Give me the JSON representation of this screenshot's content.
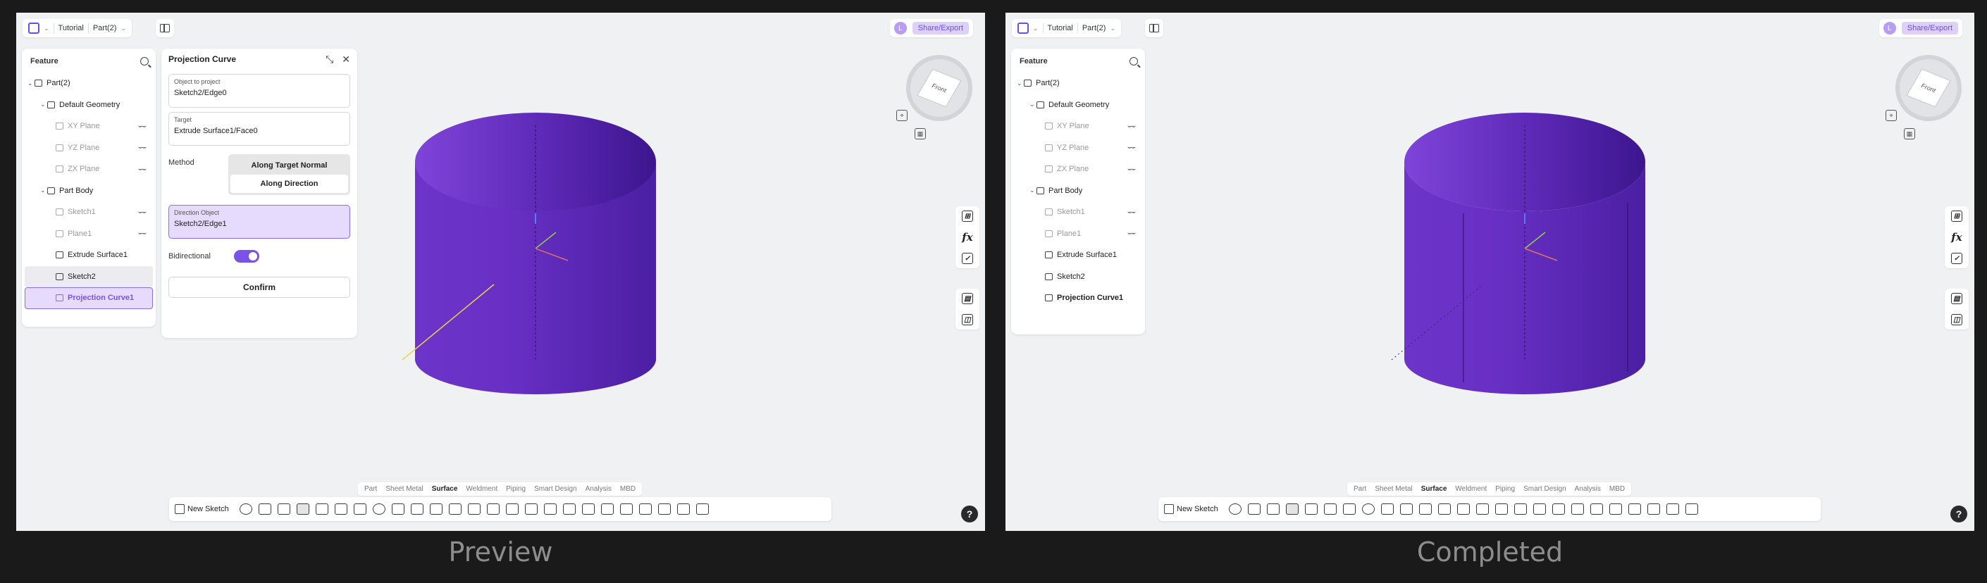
{
  "app": {
    "breadcrumb": [
      "Tutorial",
      "Part(2)"
    ],
    "avatar_initial": "L",
    "share_label": "Share/Export"
  },
  "tree": {
    "title": "Feature",
    "items": [
      {
        "label": "Part(2)",
        "level": 0,
        "caret": true,
        "hidden": false,
        "eye": false
      },
      {
        "label": "Default Geometry",
        "level": 1,
        "caret": true,
        "hidden": false,
        "eye": false
      },
      {
        "label": "XY Plane",
        "level": 2,
        "caret": false,
        "hidden": true,
        "eye": true
      },
      {
        "label": "YZ Plane",
        "level": 2,
        "caret": false,
        "hidden": true,
        "eye": true
      },
      {
        "label": "ZX Plane",
        "level": 2,
        "caret": false,
        "hidden": true,
        "eye": true
      },
      {
        "label": "Part Body",
        "level": 1,
        "caret": true,
        "hidden": false,
        "eye": false
      },
      {
        "label": "Sketch1",
        "level": 2,
        "caret": false,
        "hidden": true,
        "eye": true
      },
      {
        "label": "Plane1",
        "level": 2,
        "caret": false,
        "hidden": true,
        "eye": true
      },
      {
        "label": "Extrude Surface1",
        "level": 2,
        "caret": false,
        "hidden": false,
        "eye": false
      },
      {
        "label": "Sketch2",
        "level": 2,
        "caret": false,
        "hidden": false,
        "eye": false
      },
      {
        "label": "Projection Curve1",
        "level": 2,
        "caret": false,
        "hidden": false,
        "eye": false
      }
    ]
  },
  "dialog": {
    "title": "Projection Curve",
    "object_label": "Object to project",
    "object_value": "Sketch2/Edge0",
    "target_label": "Target",
    "target_value": "Extrude Surface1/Face0",
    "method_label": "Method",
    "method_options": [
      "Along Target Normal",
      "Along Direction"
    ],
    "direction_label": "Direction Object",
    "direction_value": "Sketch2/Edge1",
    "bidirectional_label": "Bidirectional",
    "bidirectional_on": true,
    "confirm_label": "Confirm"
  },
  "tabs": [
    "Part",
    "Sheet Metal",
    "Surface",
    "Weldment",
    "Piping",
    "Smart Design",
    "Analysis",
    "MBD"
  ],
  "active_tab": "Surface",
  "toolbar": {
    "new_sketch_label": "New Sketch"
  },
  "captions": {
    "left": "Preview",
    "right": "Completed"
  },
  "colors": {
    "accent": "#7a52e8",
    "cylinder_light": "#7a3fd6",
    "cylinder_dark": "#4a1fa0"
  }
}
